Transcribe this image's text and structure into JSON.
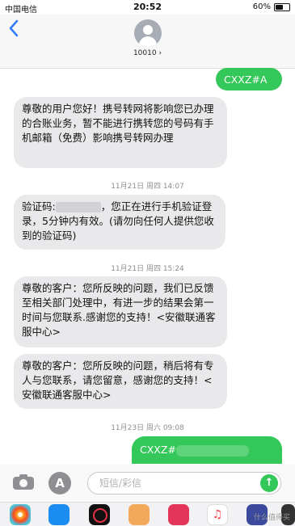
{
  "status": {
    "carrier": "中国电信",
    "time": "20:52",
    "battery_label": "60%",
    "battery_level": 0.6
  },
  "header": {
    "back_icon": "chevron-left-icon",
    "contact": "10010 ›"
  },
  "messages": [
    {
      "dir": "out",
      "text": "CXXZ#A"
    },
    {
      "dir": "in",
      "text": "尊敬的用户您好！携号转网将影响您已办理的合账业务，暂不能进行携转您的号码有手机邮箱（免费）影响携号转网办理"
    },
    {
      "dir": "ts",
      "text": "11月21日 周四 14:07"
    },
    {
      "dir": "in",
      "prefix": "验证码:",
      "text": "，您正在进行手机验证登录，5分钟内有效。(请勿向任何人提供您收到的验证码)"
    },
    {
      "dir": "ts",
      "text": "11月21日 周四 15:24"
    },
    {
      "dir": "in",
      "text": "尊敬的客户：您所反映的问题，我们已反馈至相关部门处理中，有进一步的结果会第一时间与您联系.感谢您的支持！<安徽联通客服中心>"
    },
    {
      "dir": "in",
      "text": "尊敬的客户：您所反映的问题，稍后将有专人与您联系，请您留意，感谢您的支持！<安徽联通客服中心>"
    },
    {
      "dir": "ts",
      "text": "11月23日 周六 09:08"
    },
    {
      "dir": "out",
      "text": "CXXZ#"
    }
  ],
  "input": {
    "placeholder": "短信/彩信",
    "app_icon_glyph": "A",
    "send_glyph": "↑"
  },
  "colors": {
    "incoming": "#e9e9eb",
    "outgoing": "#34c759",
    "accent": "#2f7cf6"
  },
  "dock_apps": [
    "photos-icon",
    "app-store-icon",
    "fitness-icon",
    "memoji-icon",
    "heart-icon",
    "music-icon",
    "apps-icon",
    "more-icon"
  ],
  "watermark": "什么值得买"
}
